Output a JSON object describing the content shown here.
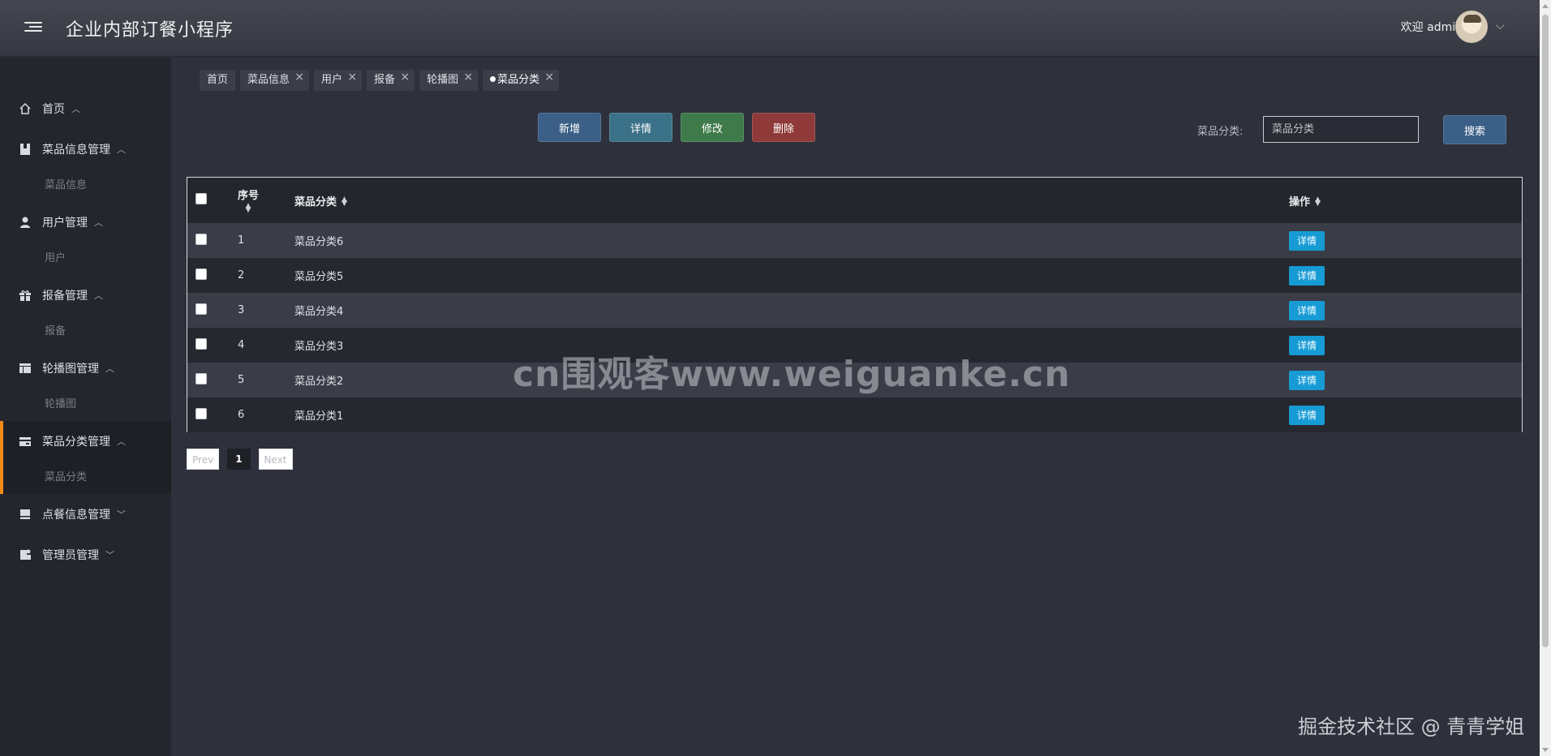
{
  "header": {
    "app_title": "企业内部订餐小程序",
    "welcome": "欢迎 admin"
  },
  "sidebar": {
    "groups": [
      {
        "label": "首页",
        "icon": "home-icon",
        "sub": []
      },
      {
        "label": "菜品信息管理",
        "icon": "book-icon",
        "sub": [
          "菜品信息"
        ]
      },
      {
        "label": "用户管理",
        "icon": "user-icon",
        "sub": [
          "用户"
        ]
      },
      {
        "label": "报备管理",
        "icon": "gift-icon",
        "sub": [
          "报备"
        ]
      },
      {
        "label": "轮播图管理",
        "icon": "layout-icon",
        "sub": [
          "轮播图"
        ]
      },
      {
        "label": "菜品分类管理",
        "icon": "card-icon",
        "sub": [
          "菜品分类"
        ]
      },
      {
        "label": "点餐信息管理",
        "icon": "tray-icon",
        "sub": []
      },
      {
        "label": "管理员管理",
        "icon": "admin-icon",
        "sub": []
      }
    ]
  },
  "tabs": [
    {
      "label": "首页",
      "closable": false
    },
    {
      "label": "菜品信息",
      "closable": true
    },
    {
      "label": "用户",
      "closable": true
    },
    {
      "label": "报备",
      "closable": true
    },
    {
      "label": "轮播图",
      "closable": true
    },
    {
      "label": "菜品分类",
      "closable": true,
      "active": true
    }
  ],
  "toolbar": {
    "add": "新增",
    "detail": "详情",
    "edit": "修改",
    "delete": "删除",
    "search_label": "菜品分类:",
    "search_placeholder": "菜品分类",
    "search_button": "搜索"
  },
  "table": {
    "headers": {
      "index": "序号",
      "name": "菜品分类",
      "ops": "操作"
    },
    "rows": [
      {
        "index": "1",
        "name": "菜品分类6",
        "action": "详情"
      },
      {
        "index": "2",
        "name": "菜品分类5",
        "action": "详情"
      },
      {
        "index": "3",
        "name": "菜品分类4",
        "action": "详情"
      },
      {
        "index": "4",
        "name": "菜品分类3",
        "action": "详情"
      },
      {
        "index": "5",
        "name": "菜品分类2",
        "action": "详情"
      },
      {
        "index": "6",
        "name": "菜品分类1",
        "action": "详情"
      }
    ]
  },
  "pagination": {
    "prev": "Prev",
    "current": "1",
    "next": "Next"
  },
  "watermarks": {
    "center": "cn围观客www.weiguanke.cn",
    "corner": "掘金技术社区 @ 青青学姐"
  },
  "colors": {
    "accent": "#f18a16",
    "detail_button": "#169bd5",
    "add_button": "#3b5f86",
    "edit_button": "#3e7a4a",
    "delete_button": "#8f3939"
  }
}
